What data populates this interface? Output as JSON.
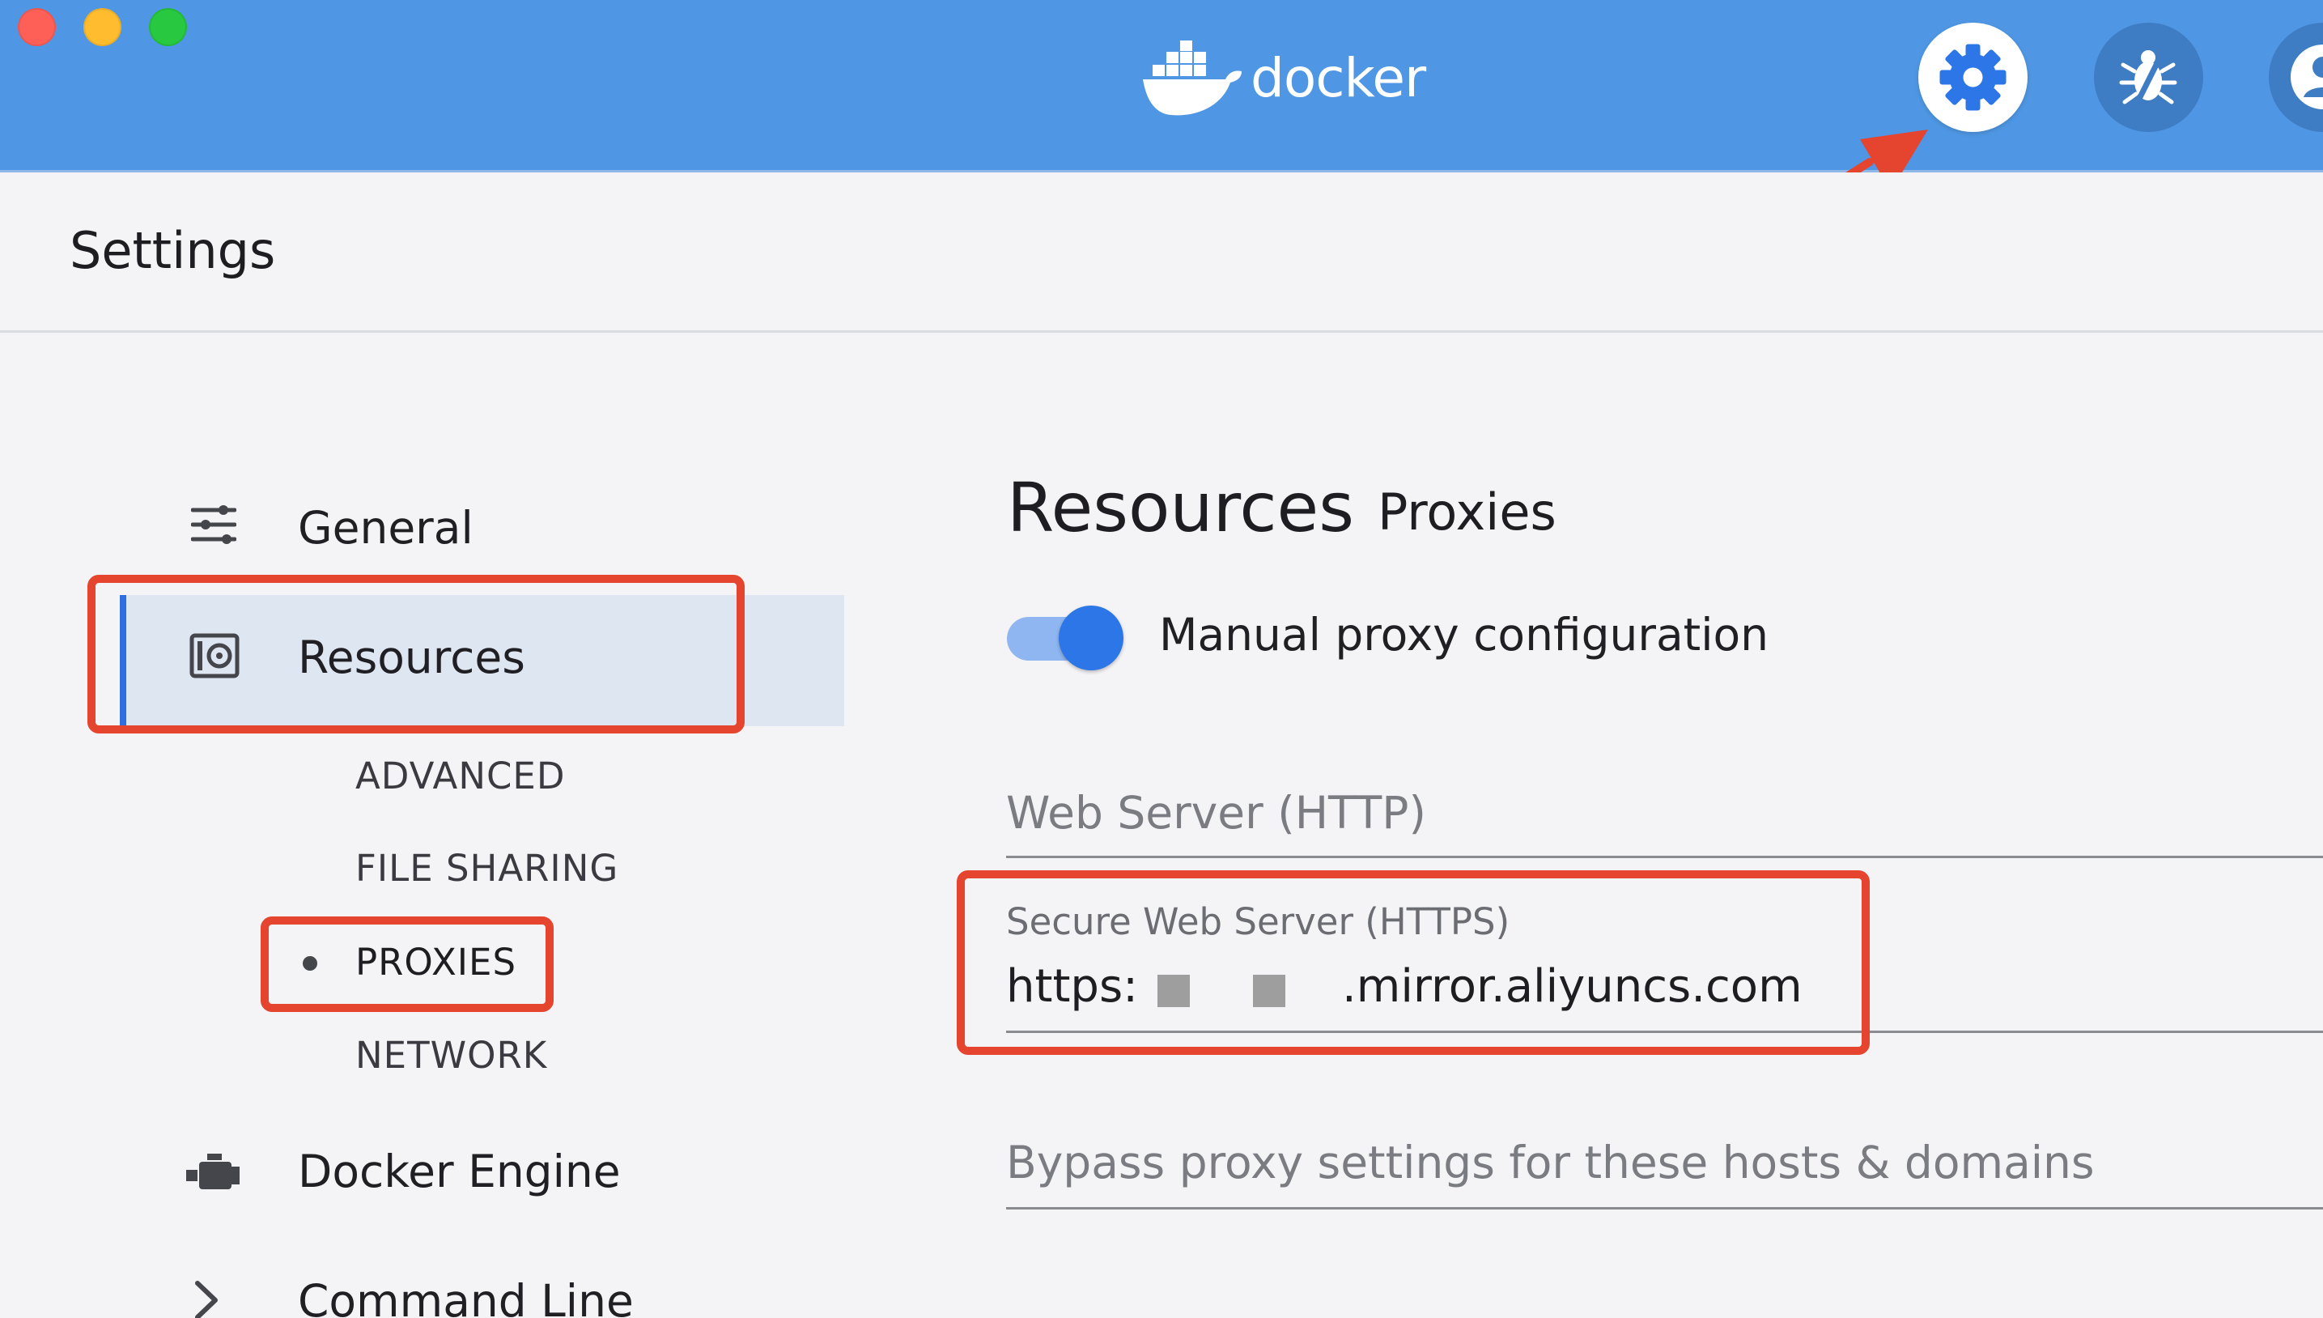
{
  "window": {
    "app_name": "docker"
  },
  "header": {
    "actions": [
      {
        "name": "settings",
        "icon": "gear-icon"
      },
      {
        "name": "troubleshoot",
        "icon": "bug-icon"
      },
      {
        "name": "account",
        "icon": "user-icon"
      }
    ],
    "colors": {
      "header_bg": "#4f97e4",
      "accent": "#2d76e8",
      "highlight": "#e5442f"
    }
  },
  "page": {
    "title": "Settings"
  },
  "sidebar": {
    "items": [
      {
        "label": "General",
        "icon": "sliders-icon"
      },
      {
        "label": "Resources",
        "icon": "resources-icon",
        "selected": true
      },
      {
        "label": "Docker Engine",
        "icon": "engine-icon"
      },
      {
        "label": "Command Line",
        "icon": "chevron-right-icon"
      }
    ],
    "subitems": [
      {
        "label": "ADVANCED"
      },
      {
        "label": "FILE SHARING"
      },
      {
        "label": "PROXIES",
        "active": true
      },
      {
        "label": "NETWORK"
      }
    ]
  },
  "content": {
    "title": "Resources",
    "subtitle": "Proxies",
    "toggle": {
      "label": "Manual proxy configuration",
      "on": true
    },
    "fields": {
      "http": {
        "placeholder": "Web Server (HTTP)"
      },
      "https": {
        "label": "Secure Web Server (HTTPS)",
        "value_prefix": "https:",
        "value_suffix": ".mirror.aliyuncs.com"
      },
      "bypass": {
        "placeholder": "Bypass proxy settings for these hosts & domains"
      }
    }
  }
}
